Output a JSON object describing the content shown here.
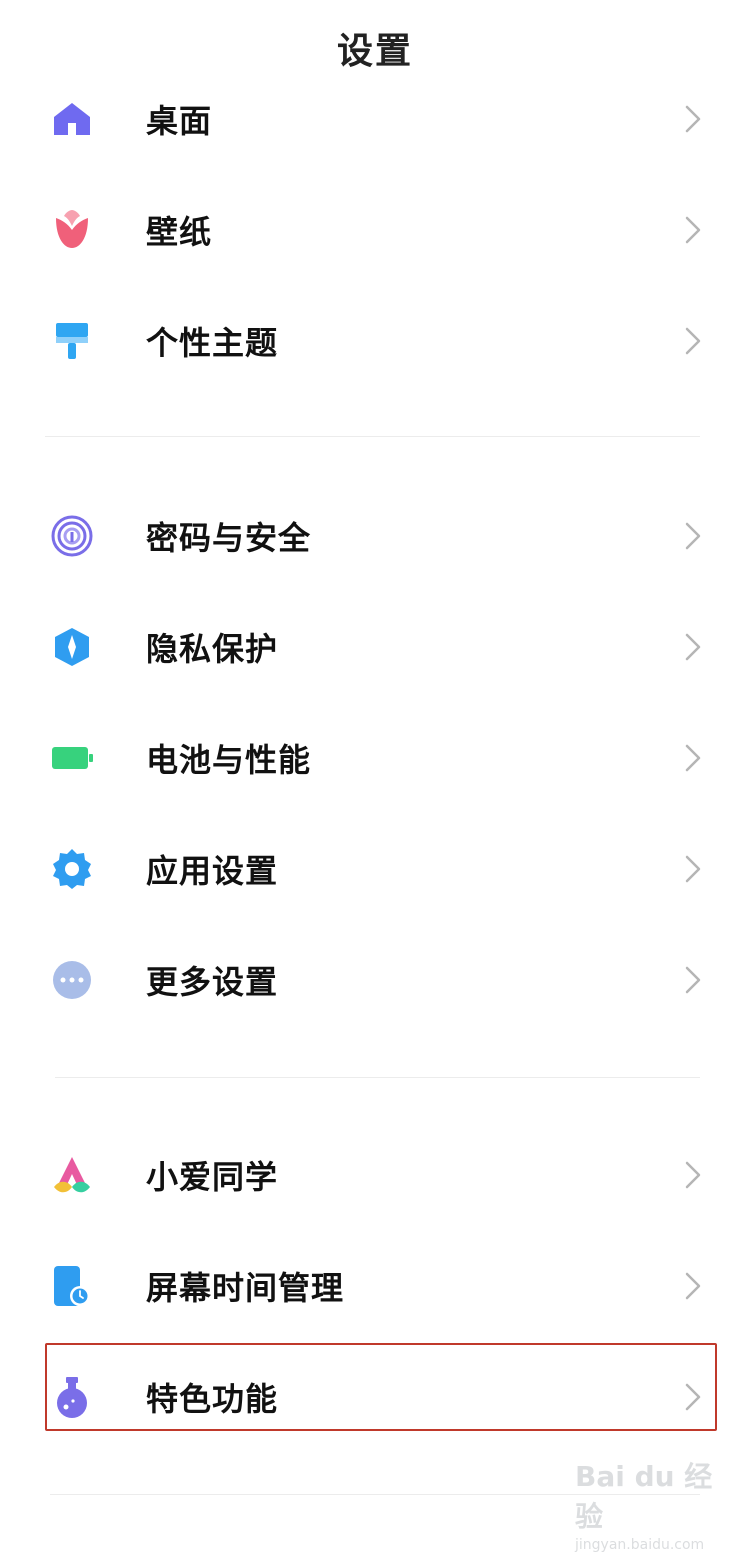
{
  "header": {
    "title": "设置"
  },
  "groups": [
    {
      "items": [
        {
          "label": "桌面",
          "icon": "home-icon",
          "color": "#6f6af0"
        },
        {
          "label": "壁纸",
          "icon": "tulip-icon",
          "color": "#f0607a"
        },
        {
          "label": "个性主题",
          "icon": "brush-icon",
          "color": "#2fa6f2"
        }
      ]
    },
    {
      "items": [
        {
          "label": "密码与安全",
          "icon": "fingerprint-icon",
          "color": "#7a6ee8"
        },
        {
          "label": "隐私保护",
          "icon": "shield-icon",
          "color": "#2f9df0"
        },
        {
          "label": "电池与性能",
          "icon": "battery-icon",
          "color": "#37d27d"
        },
        {
          "label": "应用设置",
          "icon": "gear-icon",
          "color": "#2f9df0"
        },
        {
          "label": "更多设置",
          "icon": "more-icon",
          "color": "#a9bde8"
        }
      ]
    },
    {
      "items": [
        {
          "label": "小爱同学",
          "icon": "xiaoai-icon",
          "color": "#e85aa0"
        },
        {
          "label": "屏幕时间管理",
          "icon": "screen-time-icon",
          "color": "#2f9df0"
        },
        {
          "label": "特色功能",
          "icon": "flask-icon",
          "color": "#7a6ee8"
        }
      ]
    }
  ],
  "watermark": {
    "main": "Bai du 经验",
    "sub": "jingyan.baidu.com"
  },
  "colors": {
    "chevron": "#b5b5b5",
    "divider": "#ececec",
    "highlight": "#c0392b"
  }
}
